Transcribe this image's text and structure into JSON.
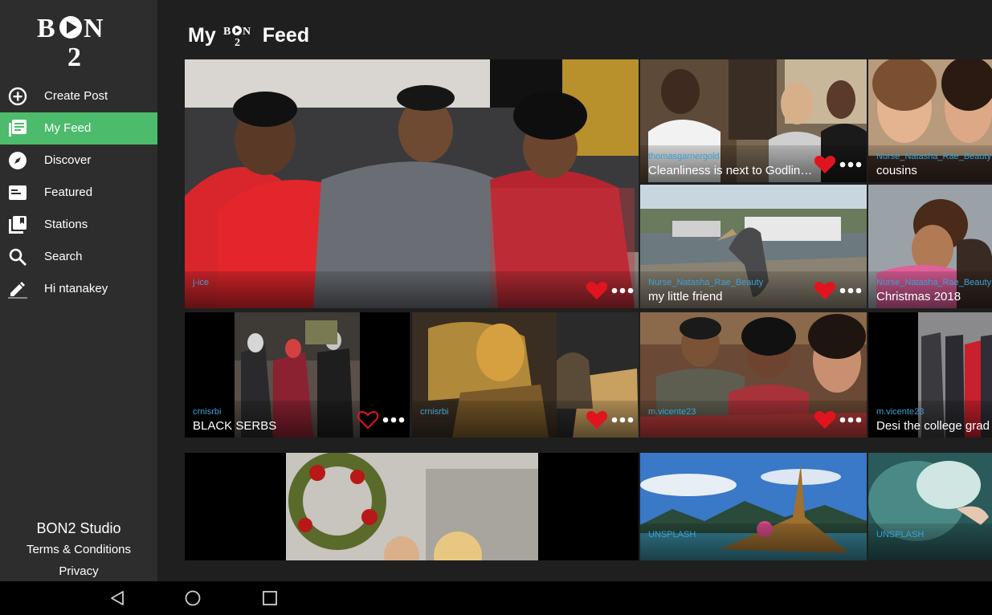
{
  "app": {
    "logo_alt": "BON2"
  },
  "sidebar": {
    "items": [
      {
        "label": "Create Post",
        "icon": "add-circle-icon",
        "active": false
      },
      {
        "label": "My Feed",
        "icon": "feed-list-icon",
        "active": true
      },
      {
        "label": "Discover",
        "icon": "compass-icon",
        "active": false
      },
      {
        "label": "Featured",
        "icon": "featured-card-icon",
        "active": false
      },
      {
        "label": "Stations",
        "icon": "stations-library-icon",
        "active": false
      },
      {
        "label": "Search",
        "icon": "search-icon",
        "active": false
      },
      {
        "label": "Hi ntanakey",
        "icon": "edit-pencil-icon",
        "active": false
      }
    ],
    "footer": {
      "studio": "BON2 Studio",
      "terms": "Terms & Conditions",
      "privacy": "Privacy"
    }
  },
  "header": {
    "title_prefix": "My",
    "title_logo": "BON2",
    "title_suffix": "Feed"
  },
  "colors": {
    "accent": "#4cbb6c",
    "author_link": "#3aa2d8",
    "heart": "#e0141e",
    "background": "#1f1f1f",
    "sidebar": "#2d2d2d"
  },
  "feed": {
    "posts": [
      {
        "author": "j-ice",
        "caption": "",
        "liked": true
      },
      {
        "author": "thomasgarnergold",
        "caption": "Cleanliness is next to Godliness",
        "liked": true
      },
      {
        "author": "Nurse_Natasha_Rae_Beauty",
        "caption": "cousins",
        "liked": false
      },
      {
        "author": "Nurse_Natasha_Rae_Beauty",
        "caption": "my little friend",
        "liked": true
      },
      {
        "author": "Nurse_Natasha_Rae_Beauty",
        "caption": "Christmas 2018",
        "liked": false
      },
      {
        "author": "crnisrbi",
        "caption": "BLACK SERBS",
        "liked": false
      },
      {
        "author": "crnisrbi",
        "caption": "",
        "liked": true
      },
      {
        "author": "m.vicente23",
        "caption": "",
        "liked": true
      },
      {
        "author": "m.vicente23",
        "caption": "Desi the college grad",
        "liked": false
      },
      {
        "author": "",
        "caption": "",
        "liked": false
      },
      {
        "author": "UNSPLASH",
        "caption": "",
        "liked": false
      },
      {
        "author": "UNSPLASH",
        "caption": "",
        "liked": false
      }
    ]
  },
  "system_nav": {
    "back": "back-triangle-icon",
    "home": "home-circle-icon",
    "recents": "recents-square-icon"
  }
}
